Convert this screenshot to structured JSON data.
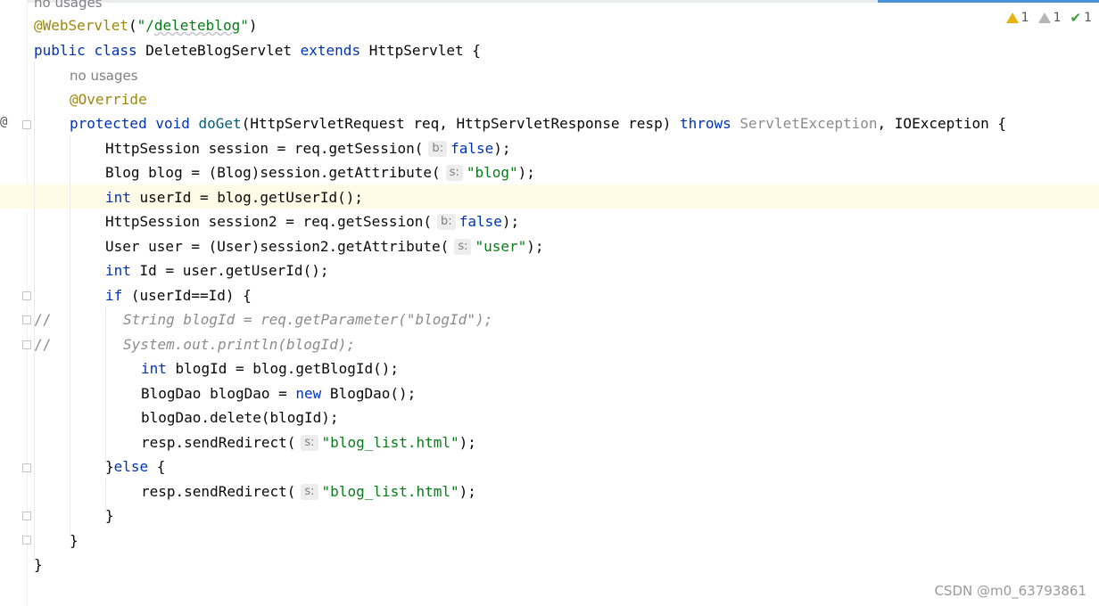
{
  "editor": {
    "usages_top": "no usages",
    "usages_method": "no usages",
    "gutter_marker": "@",
    "inlay_b": "b:",
    "inlay_s": "s:",
    "lines": {
      "l1_annotation": "@WebServlet",
      "l1_paren_open": "(",
      "l1_quote_open": "\"/",
      "l1_path": "deleteblog",
      "l1_quote_close": "\"",
      "l1_paren_close": ")",
      "l2_public": "public",
      "l2_class": "class",
      "l2_name": " DeleteBlogServlet ",
      "l2_extends": "extends",
      "l2_rest": " HttpServlet {",
      "l3_override": "@Override",
      "l4_protected": "protected",
      "l4_void": "void",
      "l4_method": "doGet",
      "l4_params": "(HttpServletRequest req, HttpServletResponse resp) ",
      "l4_throws": "throws",
      "l4_ex1": "ServletException",
      "l4_rest": ", IOException {",
      "l5_code": "HttpSession session = req.getSession(",
      "l5_false": "false",
      "l5_end": ");",
      "l6_code": "Blog blog = (Blog)session.getAttribute(",
      "l6_str": "\"blog\"",
      "l6_end": ");",
      "l7_int": "int",
      "l7_code": " userId = blog.getUserId();",
      "l8_code": "HttpSession session2 = req.getSession(",
      "l8_false": "false",
      "l8_end": ");",
      "l9_code": "User user = (User)session2.getAttribute(",
      "l9_str": "\"user\"",
      "l9_end": ");",
      "l10_int": "int",
      "l10_code": " Id = user.getUserId();",
      "l11_if": "if",
      "l11_code": " (userId==Id) {",
      "l12_slashes": "//",
      "l12_comment": "String blogId = req.getParameter(\"blogId\");",
      "l13_slashes": "//",
      "l13_comment": "System.out.println(blogId);",
      "l14_int": "int",
      "l14_code": " blogId = blog.getBlogId();",
      "l15_code1": "BlogDao blogDao = ",
      "l15_new": "new",
      "l15_code2": " BlogDao();",
      "l16_code": "blogDao.delete(blogId);",
      "l17_code": "resp.sendRedirect(",
      "l17_str": "\"blog_list.html\"",
      "l17_end": ");",
      "l18_brace": "}",
      "l18_else": "else",
      "l18_rest": " {",
      "l19_code": "resp.sendRedirect(",
      "l19_str": "\"blog_list.html\"",
      "l19_end": ");",
      "l20_brace": "}",
      "l21_brace": "}",
      "l22_brace": "}"
    }
  },
  "inspections": {
    "warnings": "1",
    "weak_warnings": "1",
    "typos": "1"
  },
  "watermark": "CSDN @m0_63793861",
  "colors": {
    "keyword": "#0033b3",
    "annotation": "#9e880d",
    "string": "#067d17",
    "comment": "#8c8c8c",
    "current_line": "#fffbe6"
  }
}
